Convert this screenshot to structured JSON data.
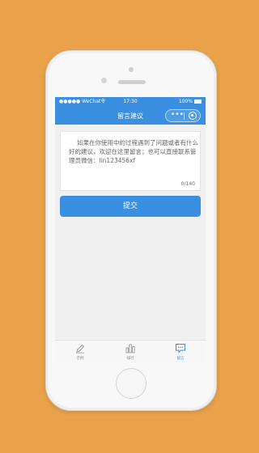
{
  "status_bar": {
    "carrier": "●●●●● WeChat",
    "wifi": "令",
    "time": "17:30",
    "battery": "100%"
  },
  "nav": {
    "title": "留言建议",
    "menu_glyph": "•••"
  },
  "feedback": {
    "text": "如果在你使用中的过程遇到了问题或者有什么好的建议，欢迎在这里留言；也可以直接联系管理员微信：lin123456xf",
    "char_count": "0/140"
  },
  "submit": {
    "label": "提交"
  },
  "tabbar": {
    "items": [
      {
        "label": "示例",
        "icon": "pencil-icon",
        "active": false
      },
      {
        "label": "排行",
        "icon": "bar-chart-icon",
        "active": false
      },
      {
        "label": "留言",
        "icon": "message-icon",
        "active": true
      }
    ]
  },
  "colors": {
    "accent": "#3a8fe0",
    "background": "#e9a24a"
  }
}
